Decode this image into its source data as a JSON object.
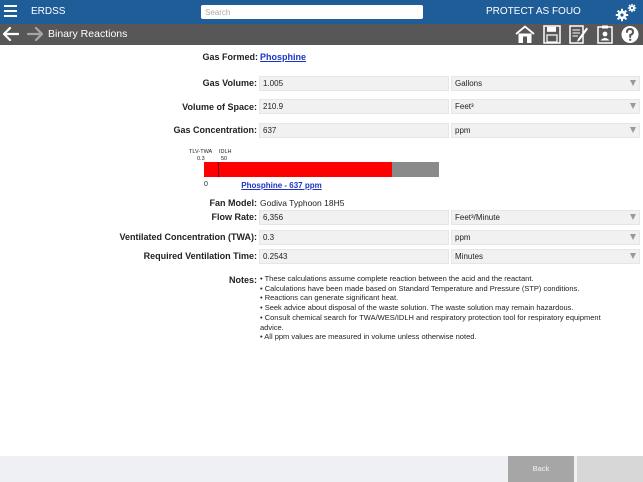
{
  "header": {
    "app_title": "ERDSS",
    "search_placeholder": "Search",
    "protect_label": "PROTECT AS FOUO",
    "settings_icon": "gears-icon",
    "menu_icon": "hamburger-icon",
    "bar_color": "#1f5d99"
  },
  "nav": {
    "title": "Binary Reactions",
    "back_icon": "arrow-left-icon",
    "forward_icon": "arrow-right-icon",
    "tools": [
      "home-icon",
      "save-icon",
      "edit-icon",
      "clipboard-icon",
      "help-icon"
    ],
    "bar_color": "#575757"
  },
  "form": {
    "gas_formed": {
      "label": "Gas Formed:",
      "value": "Phosphine"
    },
    "gas_volume": {
      "label": "Gas Volume:",
      "value": "1.005",
      "unit": "Gallons"
    },
    "volume_space": {
      "label": "Volume of Space:",
      "value": "210.9",
      "unit": "Feet³"
    },
    "gas_concentration": {
      "label": "Gas Concentration:",
      "value": "637",
      "unit": "ppm"
    },
    "fan_model": {
      "label": "Fan Model:",
      "value": "Godiva Typhoon 18H5"
    },
    "flow_rate": {
      "label": "Flow Rate:",
      "value": "6,356",
      "unit": "Feet³/Minute"
    },
    "ventilated_conc": {
      "label": "Ventilated Concentration (TWA):",
      "value": "0.3",
      "unit": "ppm"
    },
    "ventilation_time": {
      "label": "Required Ventilation Time:",
      "value": "0.2543",
      "unit": "Minutes"
    }
  },
  "exposure_bar": {
    "tlv_label": "TLV-TWA",
    "tlv_value": "0.3",
    "idlh_label": "IDLH",
    "idlh_value": "50",
    "zero_label": "0",
    "caption": "Phosphine - 637 ppm",
    "fill_fraction": 0.8,
    "fill_color": "#ff0000",
    "track_color": "#8a8a8a"
  },
  "notes": {
    "label": "Notes:",
    "items": [
      "• These calculations assume complete reaction between the acid and the reactant.",
      "• Calculations have been made based on Standard Temperature and Pressure (STP) conditions.",
      "• Reactions can generate significant heat.",
      "• Seek advice about disposal of the waste solution. The waste solution may remain hazardous.",
      "• Consult chemical search for TWA/WES/IDLH and respiratory protection tool for respiratory equipment advice.",
      "• All ppm values are measured in volume unless otherwise noted."
    ]
  },
  "footer": {
    "back_label": "Back",
    "next_label": ""
  }
}
